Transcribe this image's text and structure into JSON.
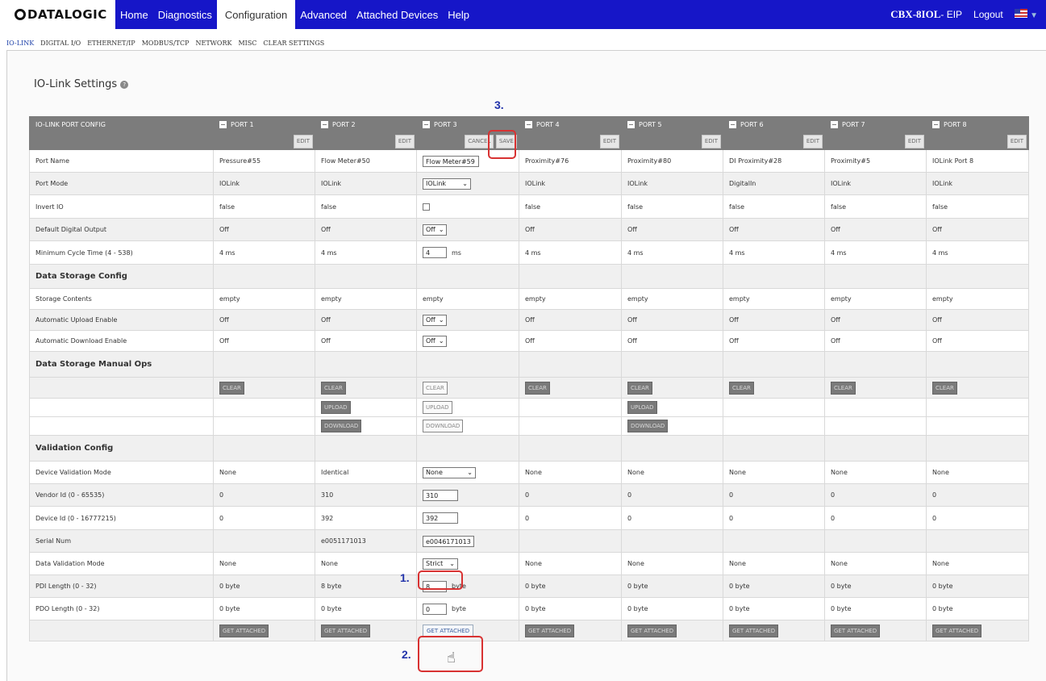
{
  "brand": {
    "logo_text": "DATALOGIC"
  },
  "nav": {
    "items": [
      "Home",
      "Diagnostics",
      "Configuration",
      "Advanced",
      "Attached Devices",
      "Help"
    ],
    "active": "Configuration",
    "device_name": "CBX-8IOL",
    "device_suffix": "- EIP",
    "logout": "Logout"
  },
  "subnav": {
    "items": [
      "IO-LINK",
      "DIGITAL I/O",
      "ETHERNET/IP",
      "MODBUS/TCP",
      "NETWORK",
      "MISC",
      "CLEAR SETTINGS"
    ],
    "active": "IO-LINK"
  },
  "page": {
    "title": "IO-Link Settings"
  },
  "table": {
    "header_label": "IO-LINK PORT CONFIG",
    "ports": [
      "PORT 1",
      "PORT 2",
      "PORT 3",
      "PORT 4",
      "PORT 5",
      "PORT 6",
      "PORT 7",
      "PORT 8"
    ],
    "edit_label": "EDIT",
    "cancel_label": "CANCEL",
    "save_label": "SAVE",
    "rows": {
      "port_name": {
        "label": "Port Name",
        "values": [
          "Pressure#55",
          "Flow Meter#50",
          "Flow Meter#59",
          "Proximity#76",
          "Proximity#80",
          "DI Proximity#28",
          "Proximity#5",
          "IOLink Port 8"
        ]
      },
      "port_mode": {
        "label": "Port Mode",
        "values": [
          "IOLink",
          "IOLink",
          "IOLink",
          "IOLink",
          "IOLink",
          "DigitalIn",
          "IOLink",
          "IOLink"
        ]
      },
      "invert_io": {
        "label": "Invert IO",
        "values": [
          "false",
          "false",
          "",
          "false",
          "false",
          "false",
          "false",
          "false"
        ]
      },
      "default_output": {
        "label": "Default Digital Output",
        "values": [
          "Off",
          "Off",
          "Off",
          "Off",
          "Off",
          "Off",
          "Off",
          "Off"
        ]
      },
      "min_cycle": {
        "label": "Minimum Cycle Time (4 - 538)",
        "values": [
          "4 ms",
          "4 ms",
          "4",
          "4 ms",
          "4 ms",
          "4 ms",
          "4 ms",
          "4 ms"
        ],
        "unit": "ms"
      },
      "ds_section": {
        "label": "Data Storage Config"
      },
      "storage_contents": {
        "label": "Storage Contents",
        "values": [
          "empty",
          "empty",
          "empty",
          "empty",
          "empty",
          "empty",
          "empty",
          "empty"
        ]
      },
      "auto_upload": {
        "label": "Automatic Upload Enable",
        "values": [
          "Off",
          "Off",
          "Off",
          "Off",
          "Off",
          "Off",
          "Off",
          "Off"
        ]
      },
      "auto_download": {
        "label": "Automatic Download Enable",
        "values": [
          "Off",
          "Off",
          "Off",
          "Off",
          "Off",
          "Off",
          "Off",
          "Off"
        ]
      },
      "ops_section": {
        "label": "Data Storage Manual Ops"
      },
      "val_section": {
        "label": "Validation Config"
      },
      "dev_val_mode": {
        "label": "Device Validation Mode",
        "values": [
          "None",
          "Identical",
          "None",
          "None",
          "None",
          "None",
          "None",
          "None"
        ]
      },
      "vendor_id": {
        "label": "Vendor Id (0 - 65535)",
        "values": [
          "0",
          "310",
          "310",
          "0",
          "0",
          "0",
          "0",
          "0"
        ]
      },
      "device_id": {
        "label": "Device Id (0 - 16777215)",
        "values": [
          "0",
          "392",
          "392",
          "0",
          "0",
          "0",
          "0",
          "0"
        ]
      },
      "serial_num": {
        "label": "Serial Num",
        "values": [
          "",
          "e0051171013",
          "e0046171013",
          "",
          "",
          "",
          "",
          ""
        ]
      },
      "data_val_mode": {
        "label": "Data Validation Mode",
        "values": [
          "None",
          "None",
          "Strict",
          "None",
          "None",
          "None",
          "None",
          "None"
        ]
      },
      "pdi_length": {
        "label": "PDI Length (0 - 32)",
        "values": [
          "0 byte",
          "8 byte",
          "8",
          "0 byte",
          "0 byte",
          "0 byte",
          "0 byte",
          "0 byte"
        ],
        "unit": "byte"
      },
      "pdo_length": {
        "label": "PDO Length (0 - 32)",
        "values": [
          "0 byte",
          "0 byte",
          "0",
          "0 byte",
          "0 byte",
          "0 byte",
          "0 byte",
          "0 byte"
        ],
        "unit": "byte"
      }
    },
    "btn_clear": "CLEAR",
    "btn_upload": "UPLOAD",
    "btn_download": "DOWNLOAD",
    "btn_get_attached": "GET ATTACHED"
  },
  "annotations": {
    "one": "1.",
    "two": "2.",
    "three": "3."
  }
}
